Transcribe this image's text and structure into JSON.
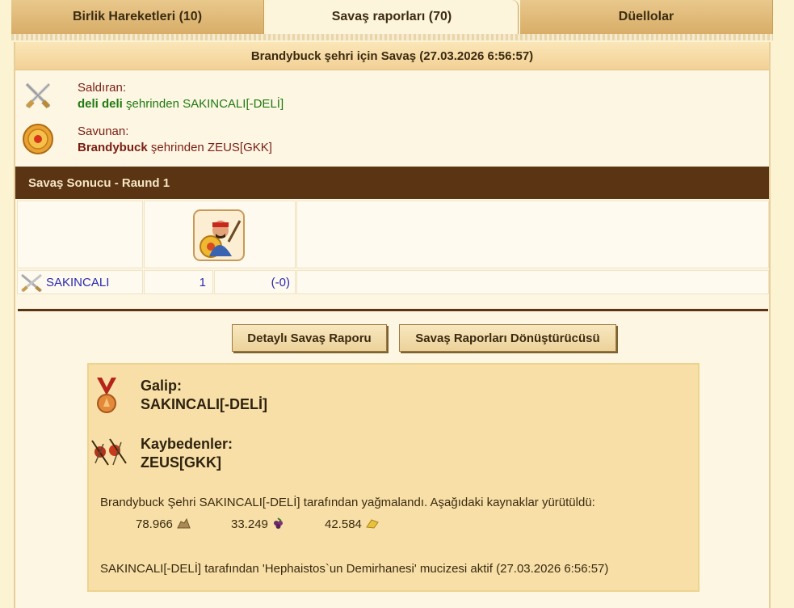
{
  "tabs": [
    {
      "label": "Birlik Hareketleri (10)"
    },
    {
      "label": "Savaş raporları (70)"
    },
    {
      "label": "Düellolar"
    }
  ],
  "report": {
    "title": "Brandybuck şehri için Savaş (27.03.2026 6:56:57)",
    "attacker_label": "Saldıran:",
    "attacker_city": "deli deli",
    "attacker_rest": " şehrinden SAKINCALI[-DELİ]",
    "defender_label": "Savunan:",
    "defender_city": "Brandybuck",
    "defender_rest": " şehrinden ZEUS[GKK]",
    "result_title": "Savaş Sonucu - Raund 1",
    "row_name": "SAKINCALI",
    "row_count": "1",
    "row_loss": "(-0)",
    "btn_detail": "Detaylı Savaş Raporu",
    "btn_convert": "Savaş Raporları Dönüştürücüsü",
    "winner_label": "Galip:",
    "winner_name": "SAKINCALI[-DELİ]",
    "loser_label": "Kaybedenler:",
    "loser_name": "ZEUS[GKK]",
    "loot_text": "Brandybuck Şehri SAKINCALI[-DELİ] tarafından yağmalandı. Aşağıdaki kaynaklar yürütüldü:",
    "resources": [
      "78.966",
      "33.249",
      "42.584"
    ],
    "miracle_text": "SAKINCALI[-DELİ] tarafından 'Hephaistos`un Demirhanesi' mucizesi aktif (27.03.2026 6:56:57)"
  },
  "icons": [
    "crossed-swords-icon",
    "shield-icon",
    "hero-portrait-icon",
    "medal-icon",
    "fallen-soldiers-icon",
    "stone-icon",
    "wine-icon",
    "gold-icon"
  ],
  "colors": {
    "accent_brown": "#5a3413",
    "attacker_green": "#1f7a10",
    "defender_maroon": "#7a1e14",
    "link_blue": "#2a2ab0"
  }
}
